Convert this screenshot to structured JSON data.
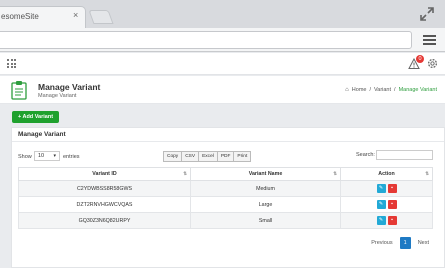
{
  "browser": {
    "tab_title": "esomeSite",
    "tab_close": "×"
  },
  "app": {
    "notification_count": "0"
  },
  "page": {
    "title": "Manage Variant",
    "subtitle": "Manage Variant",
    "breadcrumb": {
      "home": "Home",
      "sep1": "/",
      "variant": "Variant",
      "sep2": "/",
      "current": "Manage Variant"
    },
    "add_button": "+ Add Variant"
  },
  "card": {
    "title": "Manage Variant",
    "show_label": "Show",
    "length_value": "10",
    "entries_label": "entries",
    "export_buttons": [
      "Copy",
      "CSV",
      "Excel",
      "PDF",
      "Print"
    ],
    "search_label": "Search:",
    "search_value": ""
  },
  "table": {
    "columns": [
      "Variant ID",
      "Variant Name",
      "Action"
    ],
    "rows": [
      {
        "id": "C2YDWBSS8R58GWS",
        "name": "Medium"
      },
      {
        "id": "DZT2RNVHGWCVQAS",
        "name": "Large"
      },
      {
        "id": "GQ30Z3N6Q82URPY",
        "name": "Small"
      }
    ]
  },
  "pagination": {
    "previous": "Previous",
    "current": "1",
    "next": "Next"
  },
  "colors": {
    "primary_green": "#1fa12e",
    "edit_blue": "#22a9d6",
    "delete_red": "#e53935",
    "page_active": "#1f7ac4"
  }
}
